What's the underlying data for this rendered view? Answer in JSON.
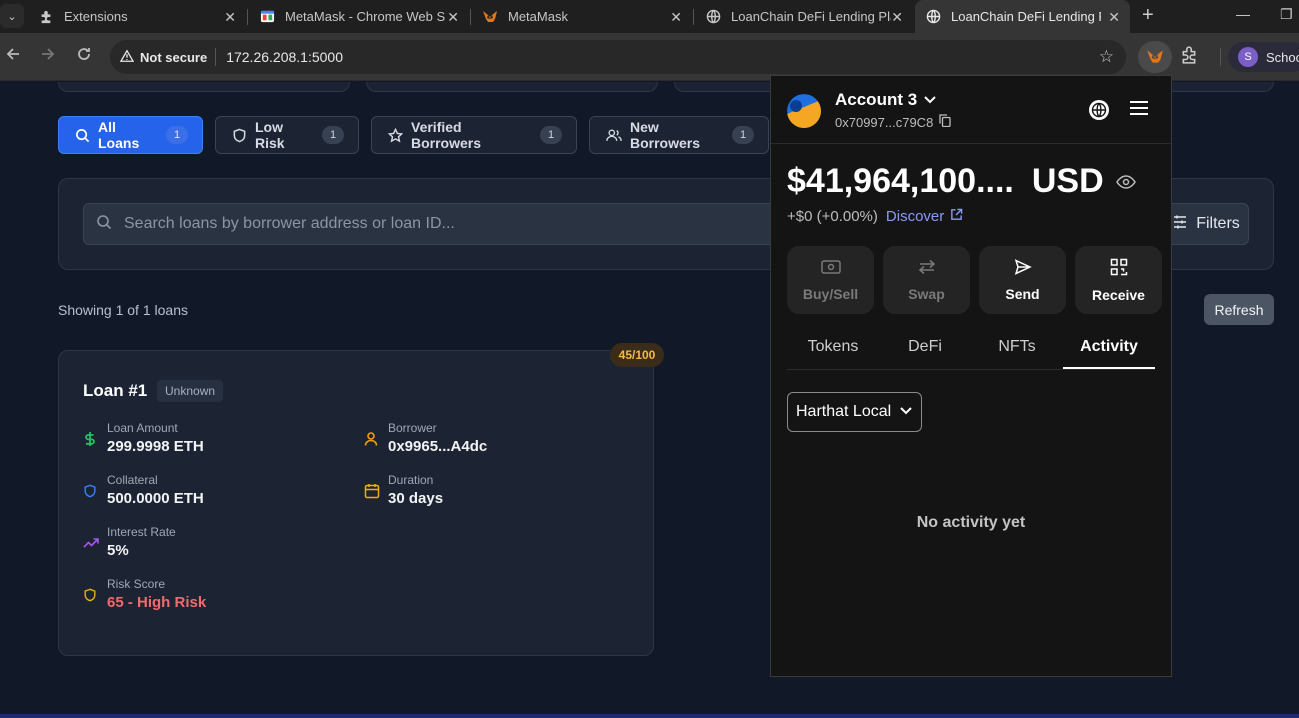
{
  "browser": {
    "tabs": [
      {
        "title": "Extensions",
        "icon": "puzzle-icon",
        "active": false
      },
      {
        "title": "MetaMask - Chrome Web St",
        "icon": "webstore-icon",
        "active": false
      },
      {
        "title": "MetaMask",
        "icon": "metamask-fox-icon",
        "active": false
      },
      {
        "title": "LoanChain DeFi Lending Plat",
        "icon": "globe-icon",
        "active": false
      },
      {
        "title": "LoanChain DeFi Lending Plat",
        "icon": "globe-icon",
        "active": true
      }
    ],
    "security_label": "Not secure",
    "url": "172.26.208.1:5000",
    "profile_initial": "S",
    "profile_name": "School"
  },
  "filters": {
    "chips": [
      {
        "label": "All Loans",
        "count": "1",
        "icon": "search-icon",
        "active": true
      },
      {
        "label": "Low Risk",
        "count": "1",
        "icon": "shield-icon",
        "active": false
      },
      {
        "label": "Verified Borrowers",
        "count": "1",
        "icon": "star-icon",
        "active": false
      },
      {
        "label": "New Borrowers",
        "count": "1",
        "icon": "users-icon",
        "active": false
      }
    ],
    "search_placeholder": "Search loans by borrower address or loan ID...",
    "filters_label": "Filters"
  },
  "results": {
    "showing": "Showing 1 of 1 loans",
    "refresh_label": "Refresh"
  },
  "loan": {
    "score_badge": "45/100",
    "title": "Loan #1",
    "status": "Unknown",
    "fields": {
      "amount": {
        "label": "Loan Amount",
        "value": "299.9998 ETH"
      },
      "borrower": {
        "label": "Borrower",
        "value": "0x9965...A4dc"
      },
      "collateral": {
        "label": "Collateral",
        "value": "500.0000 ETH"
      },
      "duration": {
        "label": "Duration",
        "value": "30 days"
      },
      "interest": {
        "label": "Interest Rate",
        "value": "5%"
      },
      "risk": {
        "label": "Risk Score",
        "value": "65 - High Risk"
      }
    }
  },
  "metamask": {
    "account_name": "Account 3",
    "address": "0x70997...c79C8",
    "balance": "$41,964,100....",
    "currency": "USD",
    "change": "+$0 (+0.00%)",
    "discover_label": "Discover",
    "actions": [
      {
        "label": "Buy/Sell",
        "icon": "card-icon",
        "enabled": false
      },
      {
        "label": "Swap",
        "icon": "swap-icon",
        "enabled": false
      },
      {
        "label": "Send",
        "icon": "send-icon",
        "enabled": true
      },
      {
        "label": "Receive",
        "icon": "qr-icon",
        "enabled": true
      }
    ],
    "tabs": [
      "Tokens",
      "DeFi",
      "NFTs",
      "Activity"
    ],
    "active_tab": "Activity",
    "network": "Harthat Local",
    "empty_message": "No activity yet"
  }
}
